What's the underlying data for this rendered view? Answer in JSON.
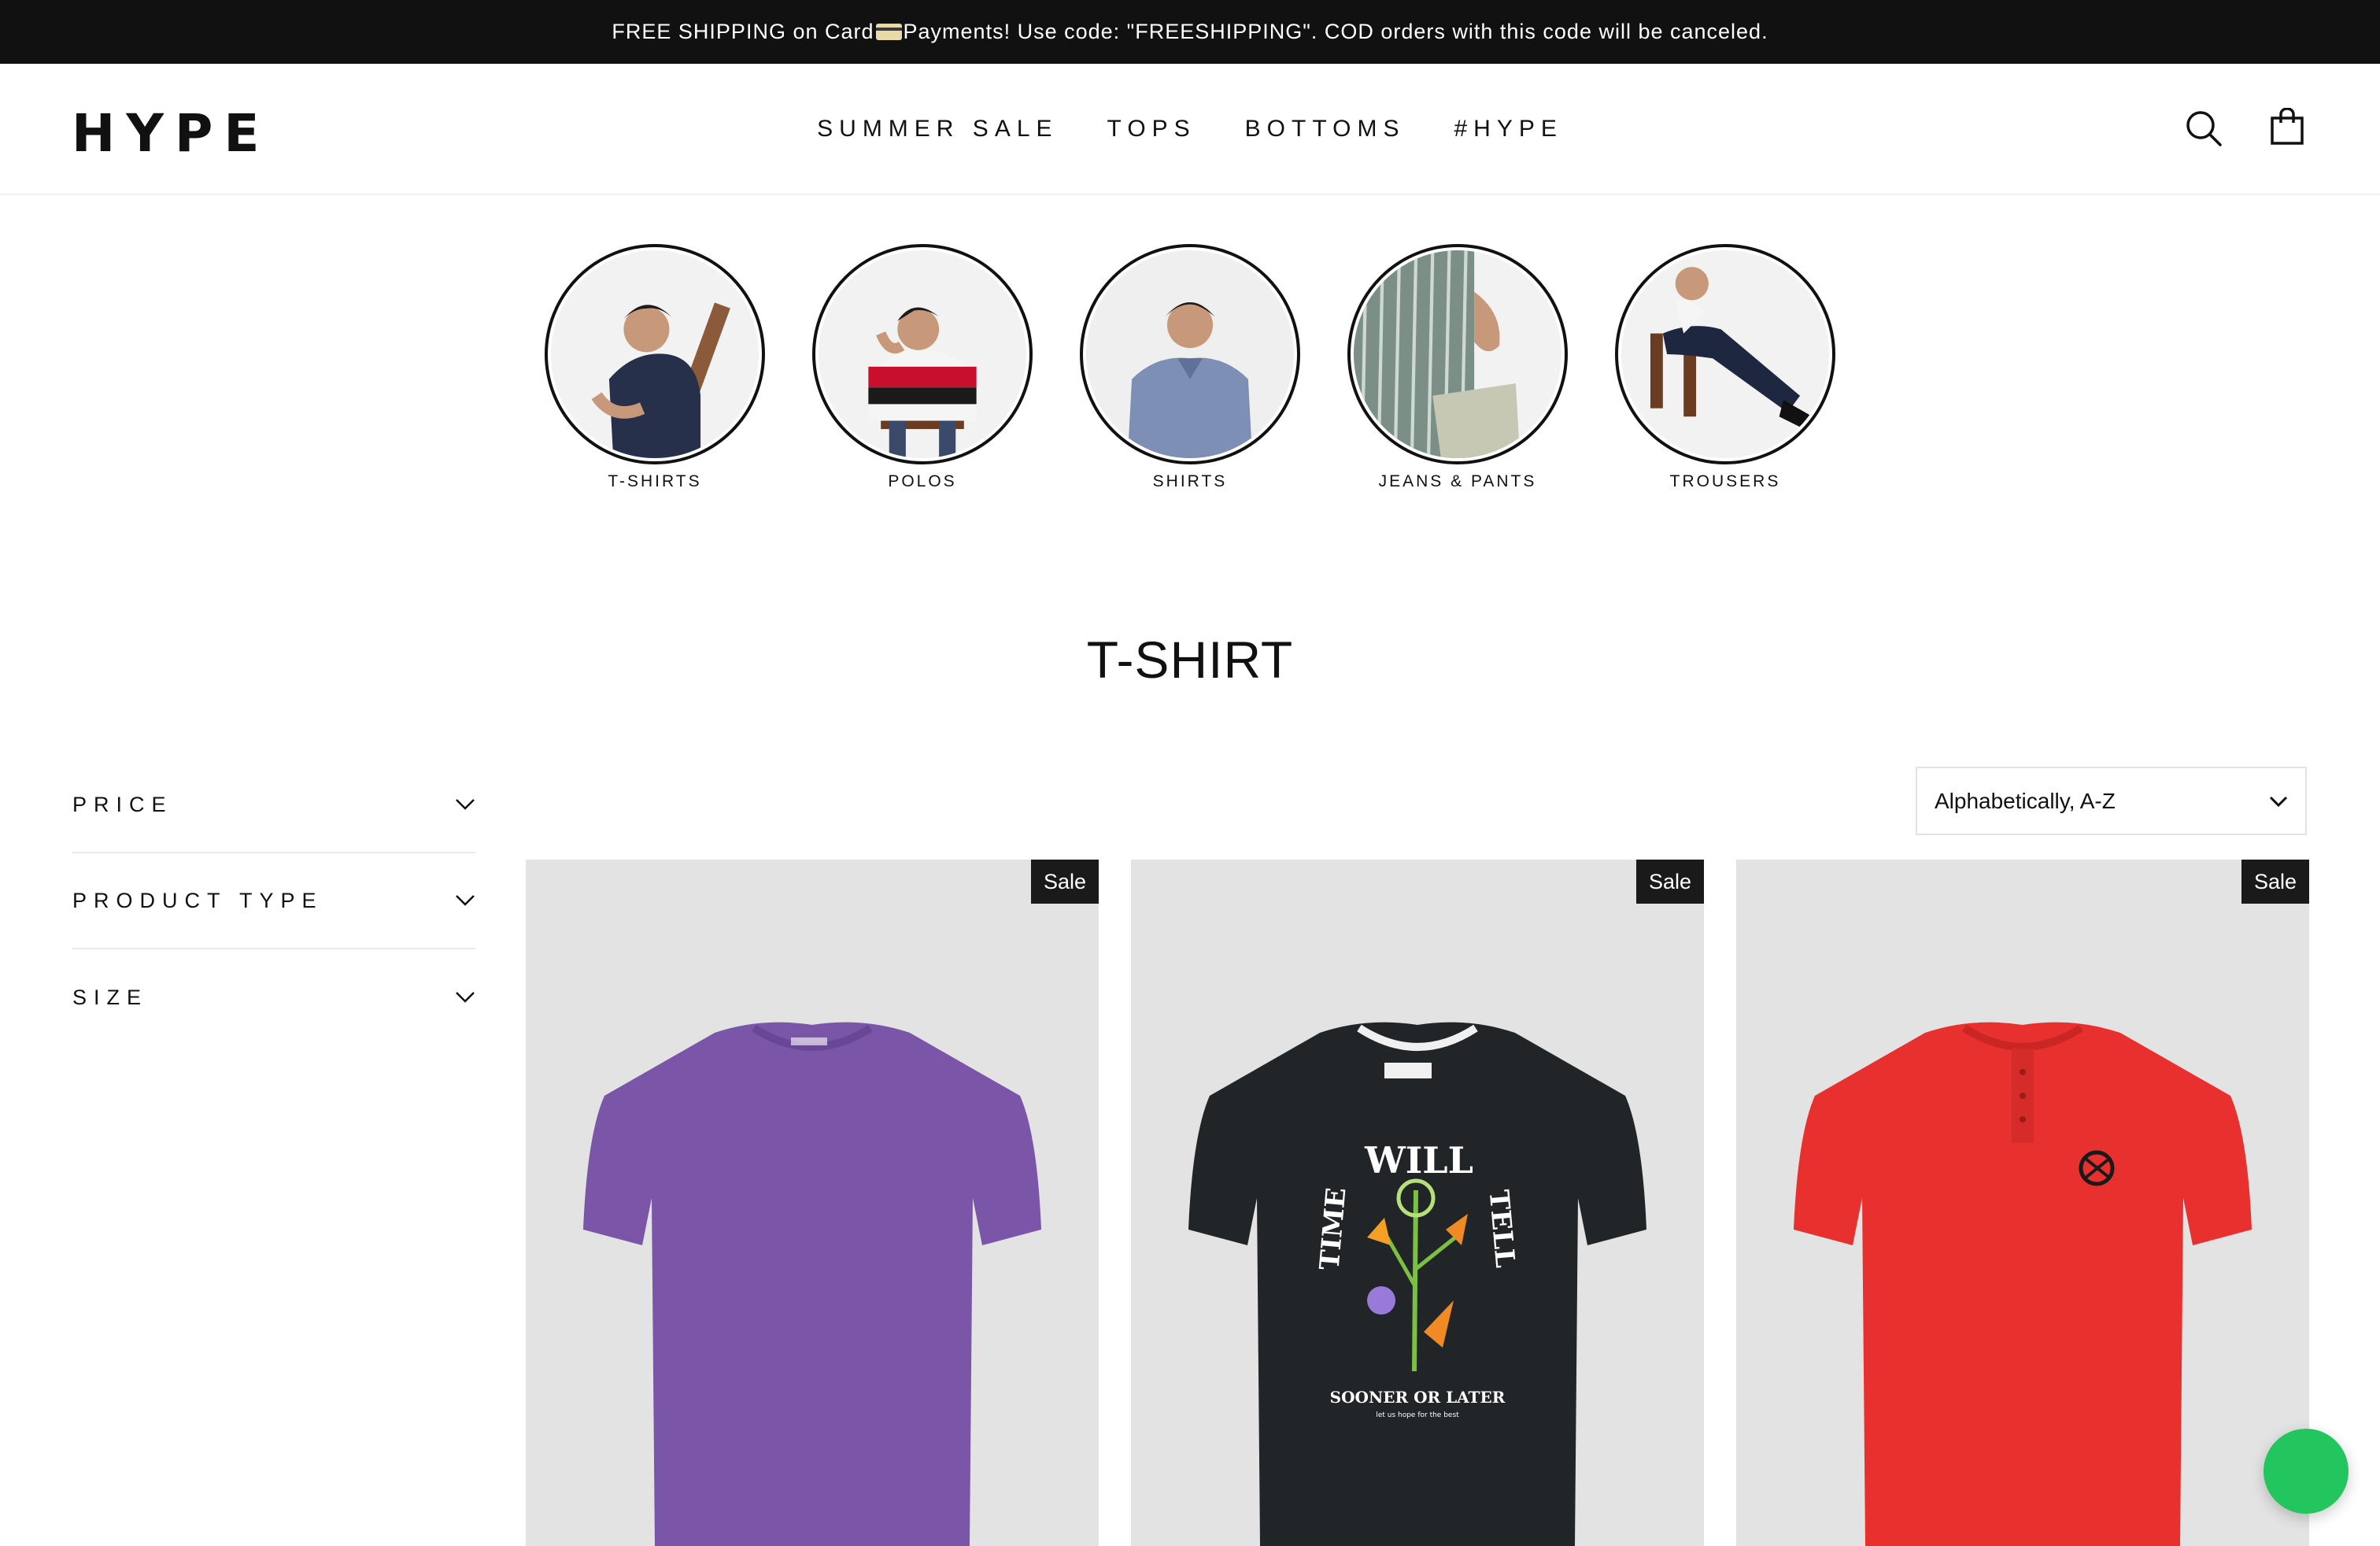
{
  "announcement": {
    "text_before": "FREE SHIPPING on Card",
    "icon": "credit-card-icon",
    "text_after": " Payments! Use code: \"FREESHIPPING\". COD orders with this code will be canceled."
  },
  "header": {
    "logo": "HYPE",
    "nav": [
      "SUMMER SALE",
      "TOPS",
      "BOTTOMS",
      "#HYPE"
    ],
    "icons": [
      "search-icon",
      "cart-icon"
    ]
  },
  "categories": [
    {
      "label": "T-SHIRTS"
    },
    {
      "label": "POLOS"
    },
    {
      "label": "SHIRTS"
    },
    {
      "label": "JEANS & PANTS"
    },
    {
      "label": "TROUSERS"
    }
  ],
  "collection": {
    "title": "T-SHIRT"
  },
  "filters": [
    {
      "label": "PRICE"
    },
    {
      "label": "PRODUCT TYPE"
    },
    {
      "label": "SIZE"
    }
  ],
  "sort": {
    "selected": "Alphabetically, A-Z"
  },
  "products": [
    {
      "badge": "Sale",
      "color": "#7a55a8"
    },
    {
      "badge": "Sale",
      "color": "#222527",
      "print_line1": "WILL",
      "print_left": "TIME",
      "print_right": "TELL",
      "print_footer": "SOONER OR LATER",
      "print_small": "let us hope for the best"
    },
    {
      "badge": "Sale",
      "color": "#e8312f"
    }
  ],
  "colors": {
    "announcement_bg": "#111111",
    "chat_button": "#22c55e",
    "product_bg": "#e3e3e3"
  }
}
